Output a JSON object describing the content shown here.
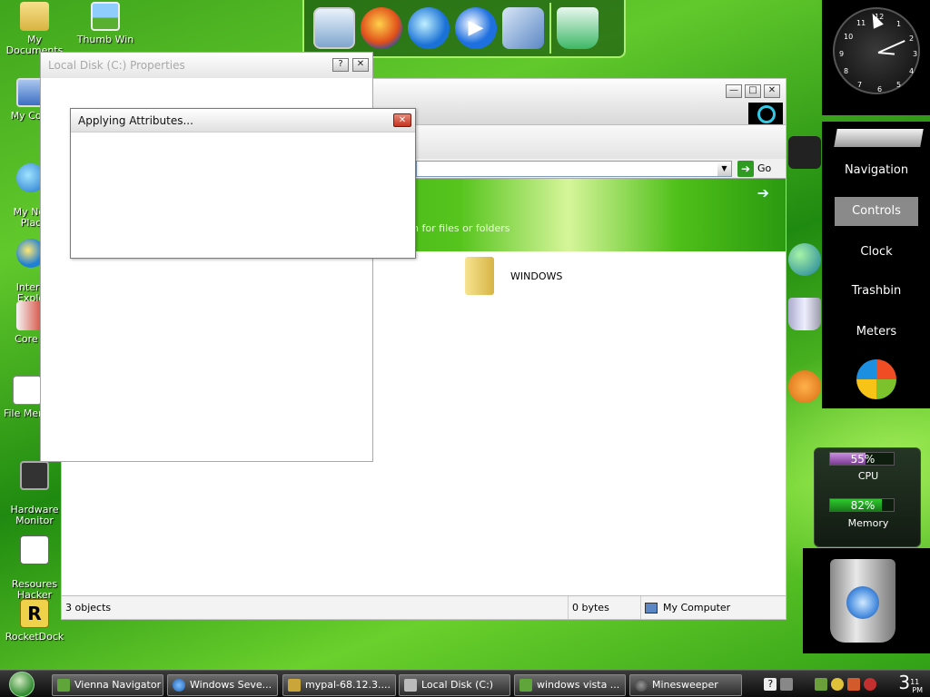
{
  "desktop": {
    "icons": [
      {
        "label": "My Documents",
        "icon": "folder-icon"
      },
      {
        "label": "Thumb Win",
        "icon": "picture-icon"
      },
      {
        "label": "My Com",
        "icon": "computer-icon"
      },
      {
        "label": "My Net\nPlac",
        "icon": "network-icon"
      },
      {
        "label": "Intern\nExplo",
        "icon": "ie-icon"
      },
      {
        "label": "Core T",
        "icon": "core-temp-icon"
      },
      {
        "label": "File Menu",
        "icon": "file-icon"
      },
      {
        "label": "Hardware\nMonitor",
        "icon": "hardware-monitor-icon"
      },
      {
        "label": "Resoures\nHacker",
        "icon": "resource-hacker-icon"
      },
      {
        "label": "RocketDock",
        "icon": "rocketdock-icon",
        "glyph": "R"
      }
    ]
  },
  "dock": {
    "items": [
      "monitor-icon",
      "firefox-icon",
      "ie-icon",
      "media-player-icon",
      "tools-icon",
      "recycle-bin-icon"
    ]
  },
  "explorer": {
    "address_go": "Go",
    "banner_text": "ch for files or folders",
    "file_name": "WINDOWS",
    "status_objects": "3 objects",
    "status_size": "0 bytes",
    "status_location": "My Computer",
    "controls": {
      "minimize": "—",
      "maximize": "□",
      "close": "✕"
    }
  },
  "properties": {
    "title": "Local Disk (C:) Properties",
    "help": "?",
    "close": "✕"
  },
  "apply_dialog": {
    "title": "Applying Attributes...",
    "close": "✕"
  },
  "sidebar": {
    "clock_numbers": [
      "12",
      "1",
      "2",
      "3",
      "4",
      "5",
      "6",
      "7",
      "8",
      "9",
      "10",
      "11"
    ],
    "nav": [
      "Navigation",
      "Controls",
      "Clock",
      "Trashbin",
      "Meters"
    ],
    "active": "Controls",
    "meters": {
      "cpu_value": "55%",
      "cpu_fraction": 0.55,
      "cpu_label": "CPU",
      "memory_value": "82%",
      "memory_fraction": 0.82,
      "memory_label": "Memory"
    }
  },
  "taskbar": {
    "tasks": [
      {
        "label": "Vienna Navigator"
      },
      {
        "label": "Windows Seve..."
      },
      {
        "label": "mypal-68.12.3...."
      },
      {
        "label": "Local Disk (C:)"
      },
      {
        "label": "windows vista ..."
      },
      {
        "label": "Minesweeper"
      }
    ],
    "time_hour": "3",
    "time_min": "11",
    "ampm": "PM"
  }
}
